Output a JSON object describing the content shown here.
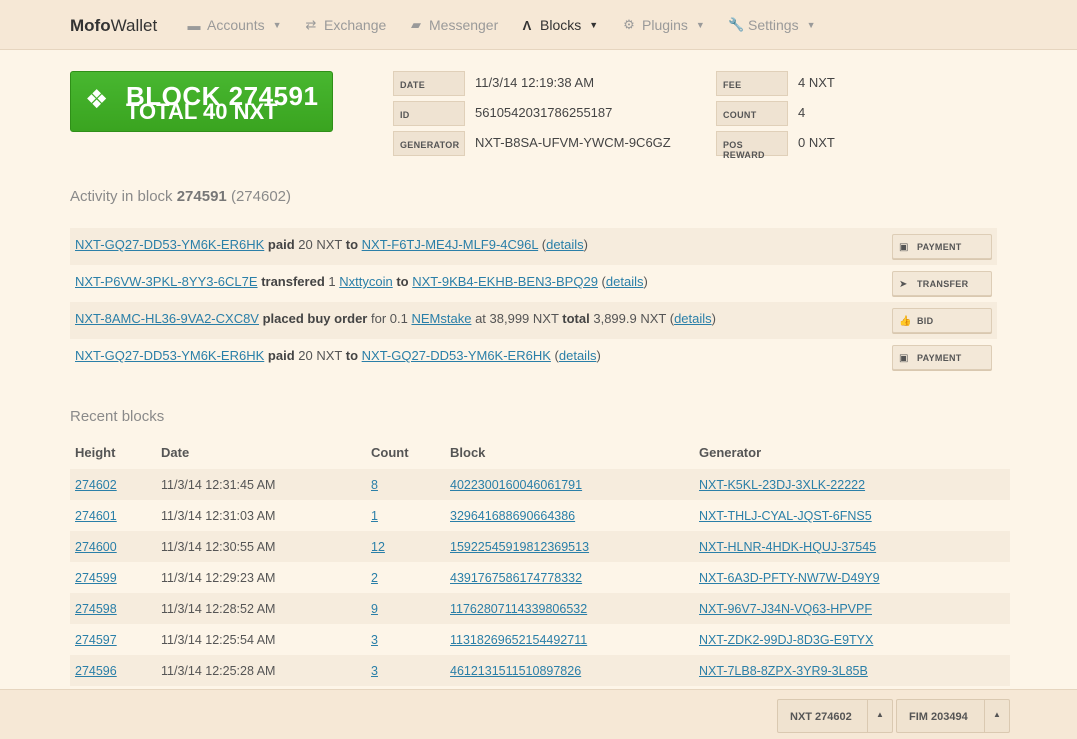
{
  "navbar": {
    "brand_bold": "Mofo",
    "brand_rest": "Wallet",
    "items": [
      {
        "label": "Accounts",
        "icon": "credit-card-icon",
        "has_caret": true
      },
      {
        "label": "Exchange",
        "icon": "exchange-icon",
        "has_caret": false
      },
      {
        "label": "Messenger",
        "icon": "chat-icon",
        "has_caret": false
      },
      {
        "label": "Blocks",
        "icon": "road-icon",
        "has_caret": true,
        "active": true
      },
      {
        "label": "Plugins",
        "icon": "gear-icon",
        "has_caret": true
      },
      {
        "label": "Settings",
        "icon": "wrench-icon",
        "has_caret": true
      }
    ]
  },
  "block": {
    "title": "BLOCK 274591",
    "total": "TOTAL 40 NXT",
    "info_left": [
      {
        "label": "DATE",
        "value": "11/3/14 12:19:38 AM"
      },
      {
        "label": "ID",
        "value": "5610542031786255187"
      },
      {
        "label": "GENERATOR",
        "value": "NXT-B8SA-UFVM-YWCM-9C6GZ"
      }
    ],
    "info_right": [
      {
        "label": "FEE",
        "value": "4 NXT"
      },
      {
        "label": "COUNT",
        "value": "4"
      },
      {
        "label": "POS REWARD",
        "value": "0 NXT"
      }
    ]
  },
  "activity": {
    "title_prefix": "Activity in block",
    "block_number": "274591",
    "block_paren": "(274602)",
    "rows": [
      {
        "from": "NXT-GQ27-DD53-YM6K-ER6HK",
        "verb": "paid",
        "amount": "20 NXT",
        "to_word": "to",
        "to": "NXT-F6TJ-ME4J-MLF9-4C96L",
        "details": "details",
        "tag": "PAYMENT",
        "tag_icon": "money-icon"
      },
      {
        "from": "NXT-P6VW-3PKL-8YY3-6CL7E",
        "verb": "transfered",
        "amount": "1",
        "asset": "Nxttycoin",
        "to_word": "to",
        "to": "NXT-9KB4-EKHB-BEN3-BPQ29",
        "details": "details",
        "tag": "TRANSFER",
        "tag_icon": "send-icon"
      },
      {
        "from": "NXT-8AMC-HL36-9VA2-CXC8V",
        "verb": "placed buy order",
        "for_text": "for 0.1",
        "asset": "NEMstake",
        "at_text": "at 38,999 NXT",
        "total_word": "total",
        "total_value": "3,899.9 NXT",
        "details": "details",
        "tag": "BID",
        "tag_icon": "thumbs-up-icon"
      },
      {
        "from": "NXT-GQ27-DD53-YM6K-ER6HK",
        "verb": "paid",
        "amount": "20 NXT",
        "to_word": "to",
        "to": "NXT-GQ27-DD53-YM6K-ER6HK",
        "details": "details",
        "tag": "PAYMENT",
        "tag_icon": "money-icon"
      }
    ]
  },
  "recent": {
    "title": "Recent blocks",
    "headers": [
      "Height",
      "Date",
      "Count",
      "Block",
      "Generator"
    ],
    "rows": [
      [
        "274602",
        "11/3/14 12:31:45 AM",
        "8",
        "4022300160046061791",
        "NXT-K5KL-23DJ-3XLK-22222"
      ],
      [
        "274601",
        "11/3/14 12:31:03 AM",
        "1",
        "329641688690664386",
        "NXT-THLJ-CYAL-JQST-6FNS5"
      ],
      [
        "274600",
        "11/3/14 12:30:55 AM",
        "12",
        "15922545919812369513",
        "NXT-HLNR-4HDK-HQUJ-37545"
      ],
      [
        "274599",
        "11/3/14 12:29:23 AM",
        "2",
        "4391767586174778332",
        "NXT-6A3D-PFTY-NW7W-D49Y9"
      ],
      [
        "274598",
        "11/3/14 12:28:52 AM",
        "9",
        "11762807114339806532",
        "NXT-96V7-J34N-VQ63-HPVPF"
      ],
      [
        "274597",
        "11/3/14 12:25:54 AM",
        "3",
        "11318269652154492711",
        "NXT-ZDK2-99DJ-8D3G-E9TYX"
      ],
      [
        "274596",
        "11/3/14 12:25:28 AM",
        "3",
        "4612131511510897826",
        "NXT-7LB8-8ZPX-3YR9-3L85B"
      ]
    ]
  },
  "footer": {
    "nxt_label": "NXT 274602",
    "fim_label": "FIM 203494"
  }
}
